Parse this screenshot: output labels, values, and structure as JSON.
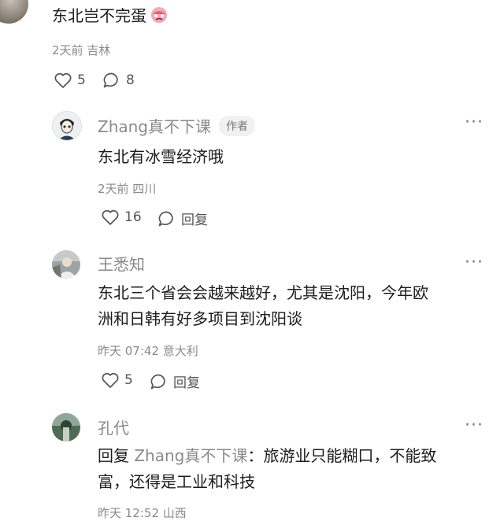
{
  "comments": [
    {
      "text": "东北岂不完蛋",
      "emoji": "crying-face-emoji",
      "meta": "2天前  吉林",
      "likes": "5",
      "replies": "8"
    },
    {
      "name": "Zhang真不下课",
      "author_tag": "作者",
      "text": "东北有冰雪经济哦",
      "meta": "2天前  四川",
      "likes": "16",
      "reply_label": "回复"
    },
    {
      "name": "王悉知",
      "text_line1": "东北三个省会会越来越好，尤其是沈阳，今年欧",
      "text_line2": "洲和日韩有好多项目到沈阳谈",
      "meta": "昨天 07:42  意大利",
      "likes": "5",
      "reply_label": "回复"
    },
    {
      "name": "孔代",
      "reply_prefix": "回复 ",
      "reply_to": "Zhang真不下课",
      "text_line1_rest": "：旅游业只能糊口，不能致",
      "text_line2": "富，还得是工业和科技",
      "meta": "昨天 12:52  山西"
    }
  ],
  "more_label": "···"
}
